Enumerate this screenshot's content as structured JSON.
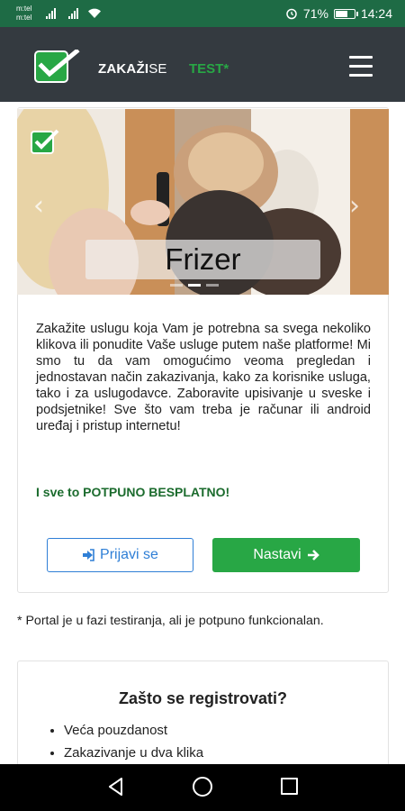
{
  "status_bar": {
    "carrier_1": "m:tel",
    "carrier_2": "m:tel",
    "battery_percent": "71%",
    "battery_level": 0.71,
    "time": "14:24",
    "icons": [
      "signal-icon",
      "signal-icon",
      "wifi-icon",
      "alarm-icon",
      "battery-icon"
    ]
  },
  "header": {
    "logo_icon": "checkmark-logo-icon",
    "brand_bold": "ZAKAŽI",
    "brand_light": "SE",
    "env_label": "TEST*",
    "menu_icon": "hamburger-menu-icon"
  },
  "hero": {
    "title": "Frizer",
    "prev_icon": "chevron-left-icon",
    "next_icon": "chevron-right-icon",
    "slides": 3,
    "active_slide": 1
  },
  "intro": {
    "text": "Zakažite uslugu koja Vam je potrebna sa svega nekoliko klikova ili ponudite Vaše usluge putem naše platforme! Mi smo tu da vam omogućimo veoma pregledan i jednostavan način zakazivanja, kako za korisnike usluga, tako i za uslugodavce. Zaboravite upisivanje u sveske i podsjetnike! Sve što vam treba je računar ili android uređaj i pristup internetu!",
    "free_text": "I sve to POTPUNO BESPLATNO!"
  },
  "actions": {
    "login_label": "Prijavi se",
    "login_icon": "sign-in-icon",
    "continue_label": "Nastavi",
    "continue_icon": "arrow-right-icon"
  },
  "note": "* Portal je u fazi testiranja, ali je potpuno funkcionalan.",
  "why_register": {
    "title": "Zašto se registrovati?",
    "items": [
      "Veća pouzdanost",
      "Zakazivanje u dva klika"
    ]
  },
  "colors": {
    "status_bar": "#1e6b45",
    "navbar": "#343a40",
    "accent_green": "#28a745",
    "dark_green_text": "#1b6b2d",
    "link_blue": "#2f7fd6"
  }
}
